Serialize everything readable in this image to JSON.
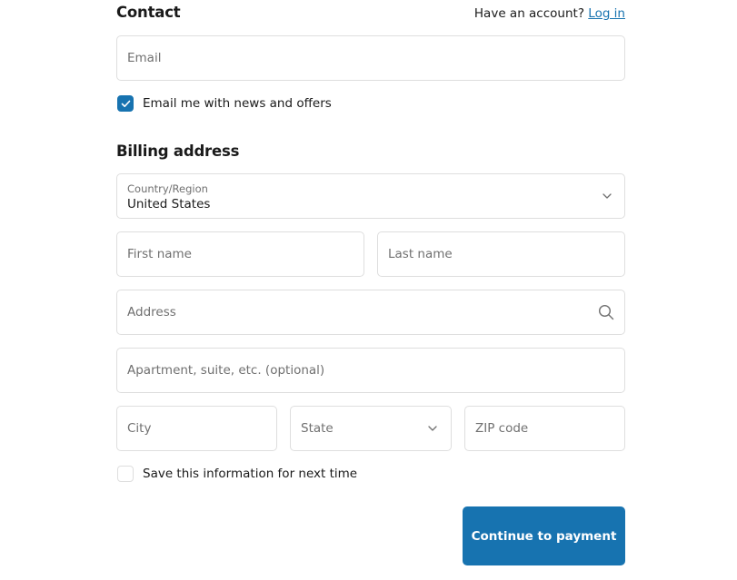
{
  "contact": {
    "title": "Contact",
    "have_account_text": "Have an account?",
    "login_link": "Log in",
    "email_placeholder": "Email",
    "newsletter_checkbox": {
      "label": "Email me with news and offers",
      "checked": true
    }
  },
  "billing": {
    "title": "Billing address",
    "country": {
      "label": "Country/Region",
      "value": "United States"
    },
    "first_name_placeholder": "First name",
    "last_name_placeholder": "Last name",
    "address_placeholder": "Address",
    "apartment_placeholder": "Apartment, suite, etc. (optional)",
    "city_placeholder": "City",
    "state": {
      "placeholder": "State"
    },
    "zip_placeholder": "ZIP code",
    "save_info_checkbox": {
      "label": "Save this information for next time",
      "checked": false
    }
  },
  "actions": {
    "continue_label": "Continue to payment"
  },
  "colors": {
    "accent": "#1773b0",
    "border": "#dedede",
    "placeholder": "#707070"
  }
}
